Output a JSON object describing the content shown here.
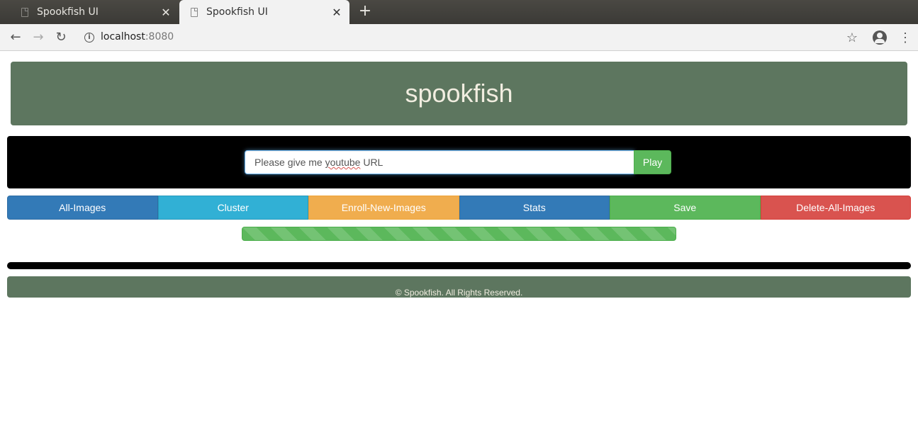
{
  "browser": {
    "tabs": [
      {
        "title": "Spookfish UI",
        "active": false
      },
      {
        "title": "Spookfish UI",
        "active": true
      }
    ],
    "new_tab_icon": "plus-icon",
    "url_host": "localhost",
    "url_port": ":8080"
  },
  "header": {
    "title": "spookfish"
  },
  "player": {
    "input_value_pre": "Please give me ",
    "input_value_misspelled": "youtube",
    "input_value_post": " URL",
    "play_label": "Play"
  },
  "actions": {
    "buttons": [
      {
        "label": "All-Images",
        "color": "#337ab7",
        "border": "#2e6da4"
      },
      {
        "label": "Cluster",
        "color": "#31b0d5",
        "border": "#269abc"
      },
      {
        "label": "Enroll-New-Images",
        "color": "#f0ad4e",
        "border": "#eea236"
      },
      {
        "label": "Stats",
        "color": "#337ab7",
        "border": "#2e6da4"
      },
      {
        "label": "Save",
        "color": "#5cb85c",
        "border": "#4cae4c"
      },
      {
        "label": "Delete-All-Images",
        "color": "#d9534f",
        "border": "#d43f3a"
      }
    ]
  },
  "progress": {
    "value_percent": 100,
    "color": "#5cb85c"
  },
  "footer": {
    "text": "© Spookfish. All Rights Reserved."
  },
  "colors": {
    "panel_green": "#5d765f",
    "panel_text": "#f1ede0"
  }
}
